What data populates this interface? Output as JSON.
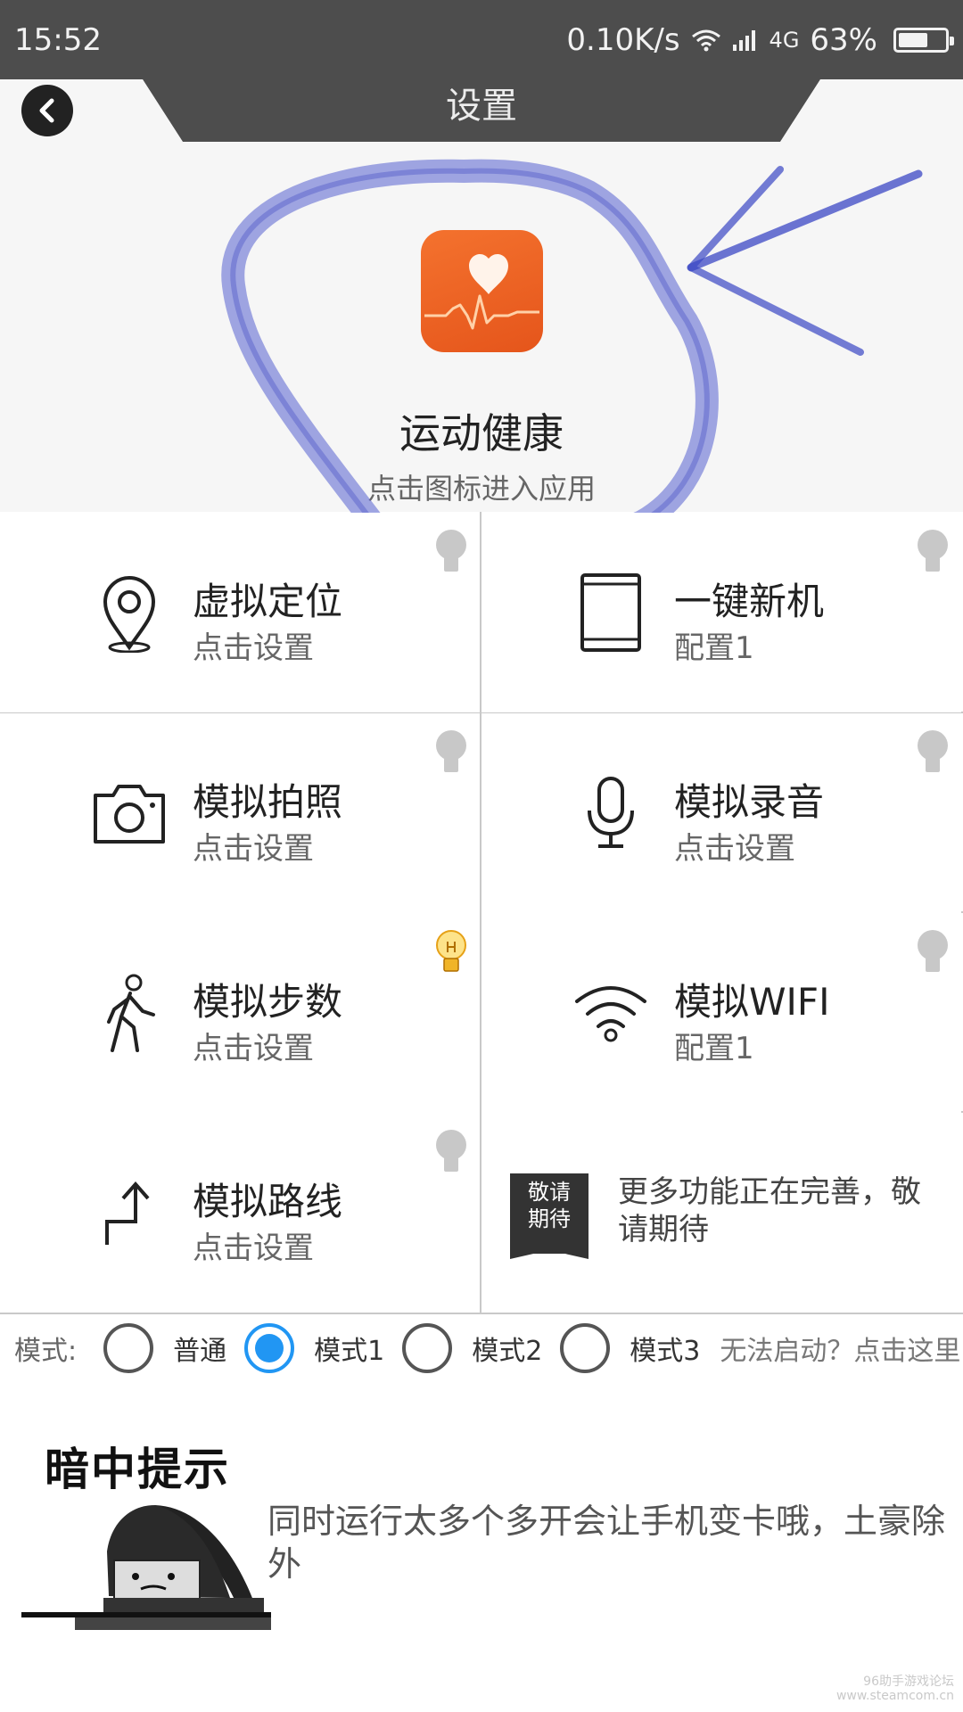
{
  "status_bar": {
    "time": "15:52",
    "net_speed": "0.10K/s",
    "network_type": "4G",
    "battery": "63%",
    "battery_level": 0.63
  },
  "header": {
    "title": "设置",
    "back_icon": "chevron-left-icon"
  },
  "hero": {
    "app_icon": "heart-pulse-icon",
    "app_name": "运动健康",
    "hint": "点击图标进入应用"
  },
  "grid": [
    {
      "name": "虚拟定位",
      "sub": "点击设置",
      "icon": "location-pin-icon",
      "hint_lit": false
    },
    {
      "name": "一键新机",
      "sub": "配置1",
      "icon": "phone-device-icon",
      "hint_lit": false
    },
    {
      "name": "模拟拍照",
      "sub": "点击设置",
      "icon": "camera-icon",
      "hint_lit": false
    },
    {
      "name": "模拟录音",
      "sub": "点击设置",
      "icon": "microphone-icon",
      "hint_lit": false
    },
    {
      "name": "模拟步数",
      "sub": "点击设置",
      "icon": "walking-person-icon",
      "hint_lit": true
    },
    {
      "name": "模拟WIFI",
      "sub": "配置1",
      "icon": "wifi-icon",
      "hint_lit": false
    },
    {
      "name": "模拟路线",
      "sub": "点击设置",
      "icon": "route-arrow-icon",
      "hint_lit": false
    }
  ],
  "coming_soon": {
    "badge_line1": "敬请",
    "badge_line2": "期待",
    "text": "更多功能正在完善，敬请期待"
  },
  "modes": {
    "label": "模式:",
    "options": [
      "普通",
      "模式1",
      "模式2",
      "模式3"
    ],
    "selected": "模式1",
    "help_link": "无法启动？点击这里"
  },
  "tip": {
    "title": "暗中提示",
    "text": "同时运行太多个多开会让手机变卡哦，土豪除外"
  },
  "colors": {
    "status_bar": "#4d4d4d",
    "accent": "#2196f3",
    "app_icon": "#e5551b",
    "annotation": "#5560d0"
  }
}
